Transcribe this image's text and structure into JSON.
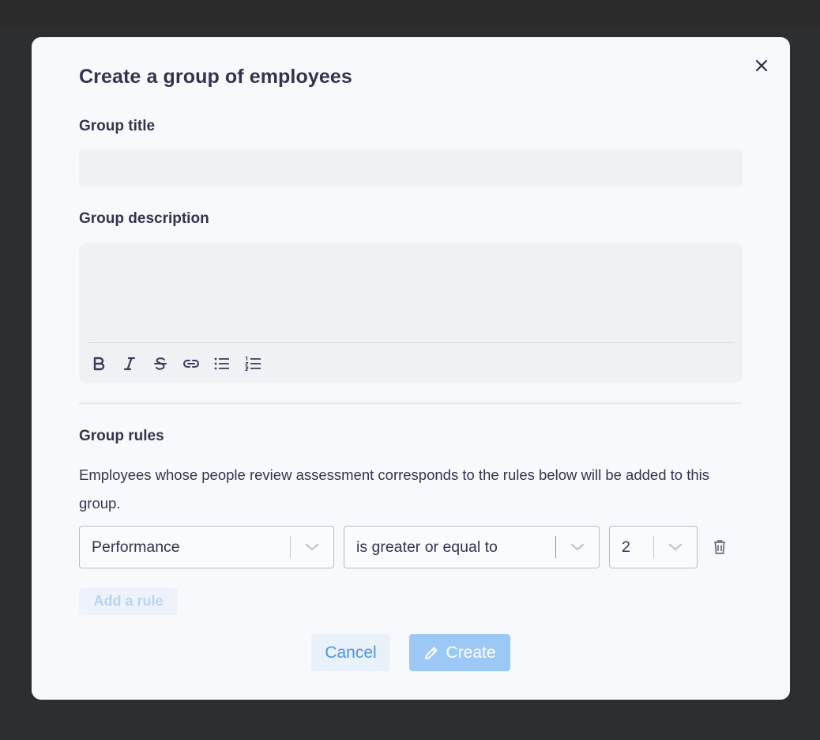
{
  "modal": {
    "title": "Create a group of employees",
    "close_icon": "close-icon"
  },
  "form": {
    "group_title_label": "Group title",
    "group_title_value": "",
    "group_description_label": "Group description",
    "group_description_value": "",
    "toolbar": [
      {
        "icon": "bold-icon"
      },
      {
        "icon": "italic-icon"
      },
      {
        "icon": "strikethrough-icon"
      },
      {
        "icon": "link-icon"
      },
      {
        "icon": "bulleted-list-icon"
      },
      {
        "icon": "numbered-list-icon"
      }
    ]
  },
  "rules": {
    "heading": "Group rules",
    "description": "Employees whose people review assessment corresponds to the rules below will be added to this group.",
    "items": [
      {
        "criterion": "Performance",
        "operator": "is greater or equal to",
        "value": "2"
      }
    ],
    "add_rule_label": "Add a rule"
  },
  "actions": {
    "cancel_label": "Cancel",
    "create_label": "Create"
  },
  "colors": {
    "accent": "#4a93e6",
    "primary_disabled": "#9cc8f6",
    "text": "#33334f",
    "modal_bg": "#f8f9fc",
    "field_bg": "#f0f1f5"
  }
}
